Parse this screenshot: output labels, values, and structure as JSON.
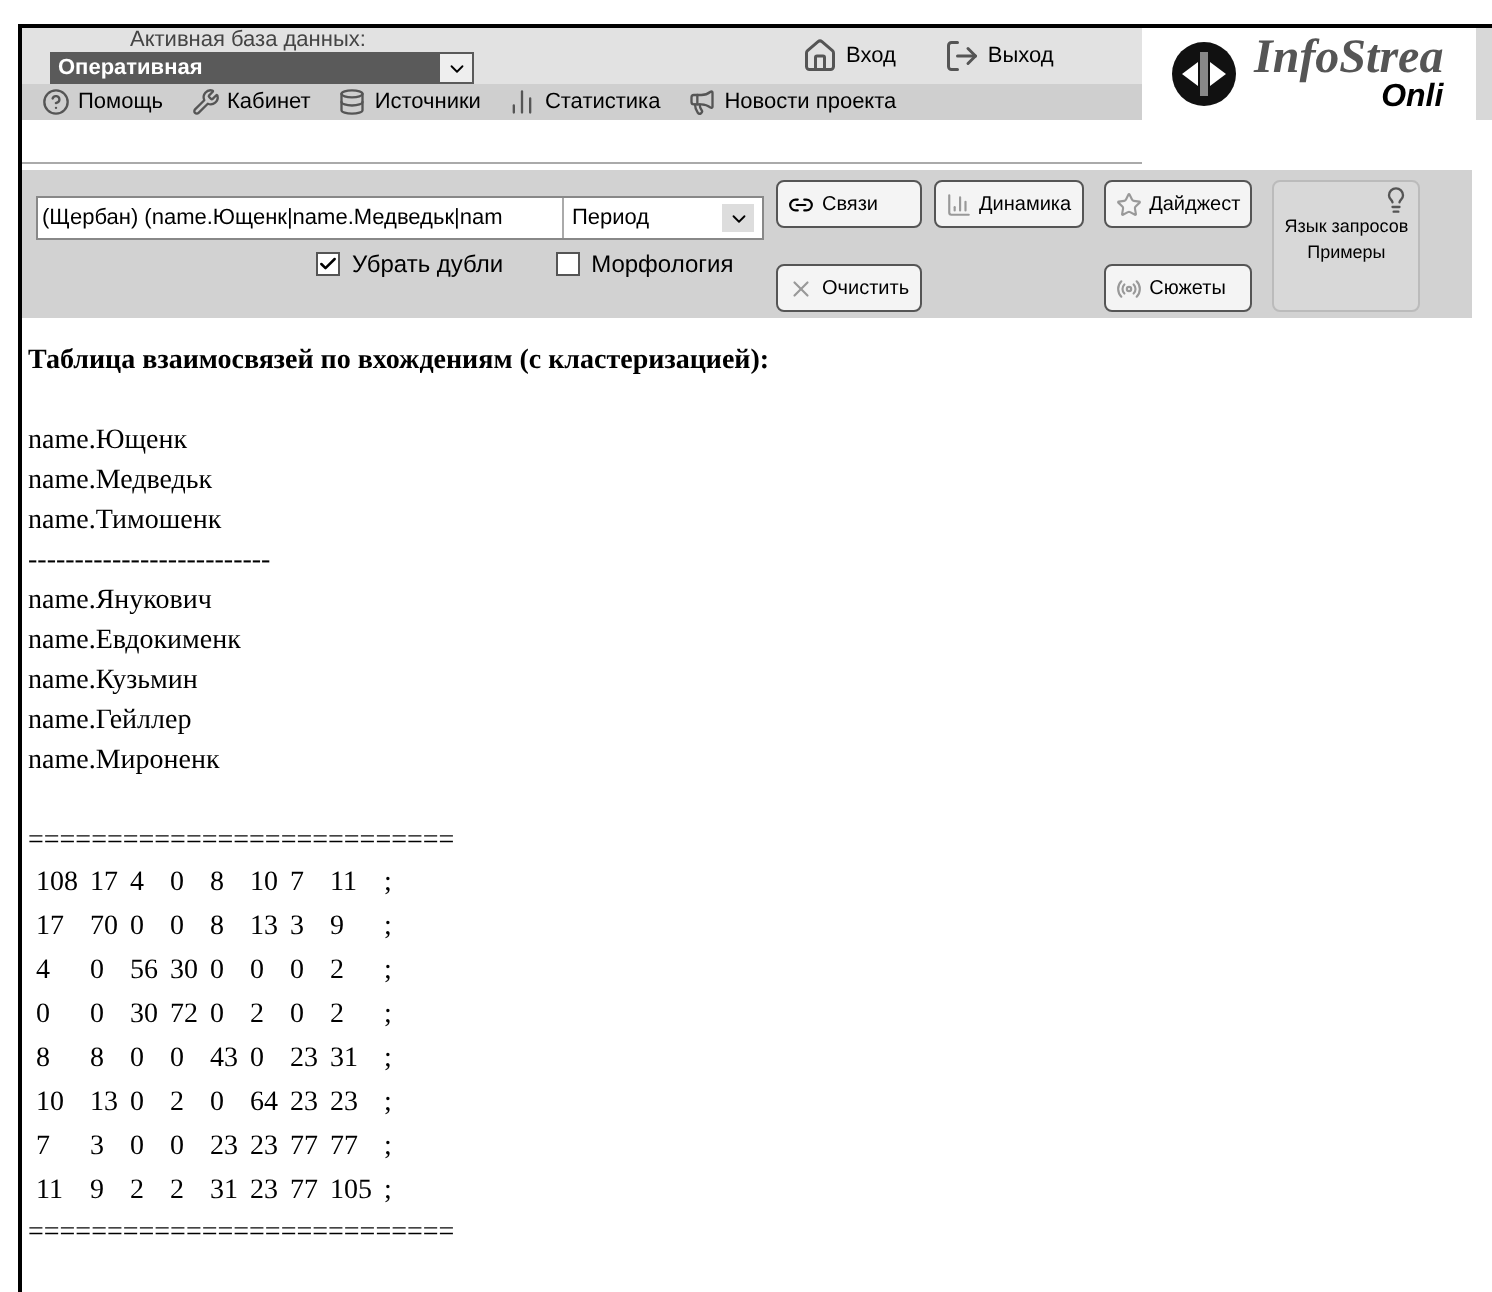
{
  "header": {
    "db_label": "Активная база данных:",
    "db_value": "Оперативная",
    "login": "Вход",
    "logout": "Выход",
    "logo_top": "InfoStrea",
    "logo_bottom": "Onli"
  },
  "nav": [
    {
      "label": "Помощь",
      "kind": "help"
    },
    {
      "label": "Кабинет",
      "kind": "tools"
    },
    {
      "label": "Источники",
      "kind": "sources"
    },
    {
      "label": "Статистика",
      "kind": "stats"
    },
    {
      "label": "Новости проекта",
      "kind": "news"
    }
  ],
  "query": {
    "value": "(Щербан) (name.Ющенк|name.Медведьк|nam",
    "period": "Период"
  },
  "options": [
    {
      "label": "Убрать дубли",
      "checked": true
    },
    {
      "label": "Морфология",
      "checked": false
    }
  ],
  "buttons": [
    {
      "label": "Связи",
      "kind": "links"
    },
    {
      "label": "Динамика",
      "kind": "dynamics"
    },
    {
      "label": "Дайджест",
      "kind": "digest"
    },
    {
      "label": "Очистить",
      "kind": "clear"
    },
    {
      "label": "Сюжеты",
      "kind": "stories"
    }
  ],
  "help": {
    "line1": "Язык запросов",
    "line2": "Примеры"
  },
  "report": {
    "title": "Таблица взаимосвязей по вхождениям (с кластеризацией):",
    "cluster_1": [
      "name.Ющенк",
      "name.Медведьк",
      "name.Тимошенк"
    ],
    "separator": "--------------------------",
    "cluster_2": [
      "name.Янукович",
      "name.Евдокименк",
      "name.Кузьмин",
      "name.Гейллер",
      "name.Мироненк"
    ],
    "rule_top": "===========================",
    "matrix": [
      [
        "108",
        "17",
        "4",
        "0",
        "8",
        "10",
        "7",
        "11",
        ";"
      ],
      [
        "17",
        "70",
        "0",
        "0",
        "8",
        "13",
        "3",
        "9",
        ";"
      ],
      [
        "4",
        "0",
        "56",
        "30",
        "0",
        "0",
        "0",
        "2",
        ";"
      ],
      [
        "0",
        "0",
        "30",
        "72",
        "0",
        "2",
        "0",
        "2",
        ";"
      ],
      [
        "8",
        "8",
        "0",
        "0",
        "43",
        "0",
        "23",
        "31",
        ";"
      ],
      [
        "10",
        "13",
        "0",
        "2",
        "0",
        "64",
        "23",
        "23",
        ";"
      ],
      [
        "7",
        "3",
        "0",
        "0",
        "23",
        "23",
        "77",
        "77",
        ";"
      ],
      [
        "11",
        "9",
        "2",
        "2",
        "31",
        "23",
        "77",
        "105",
        ";"
      ]
    ],
    "rule_bottom": "==========================="
  }
}
